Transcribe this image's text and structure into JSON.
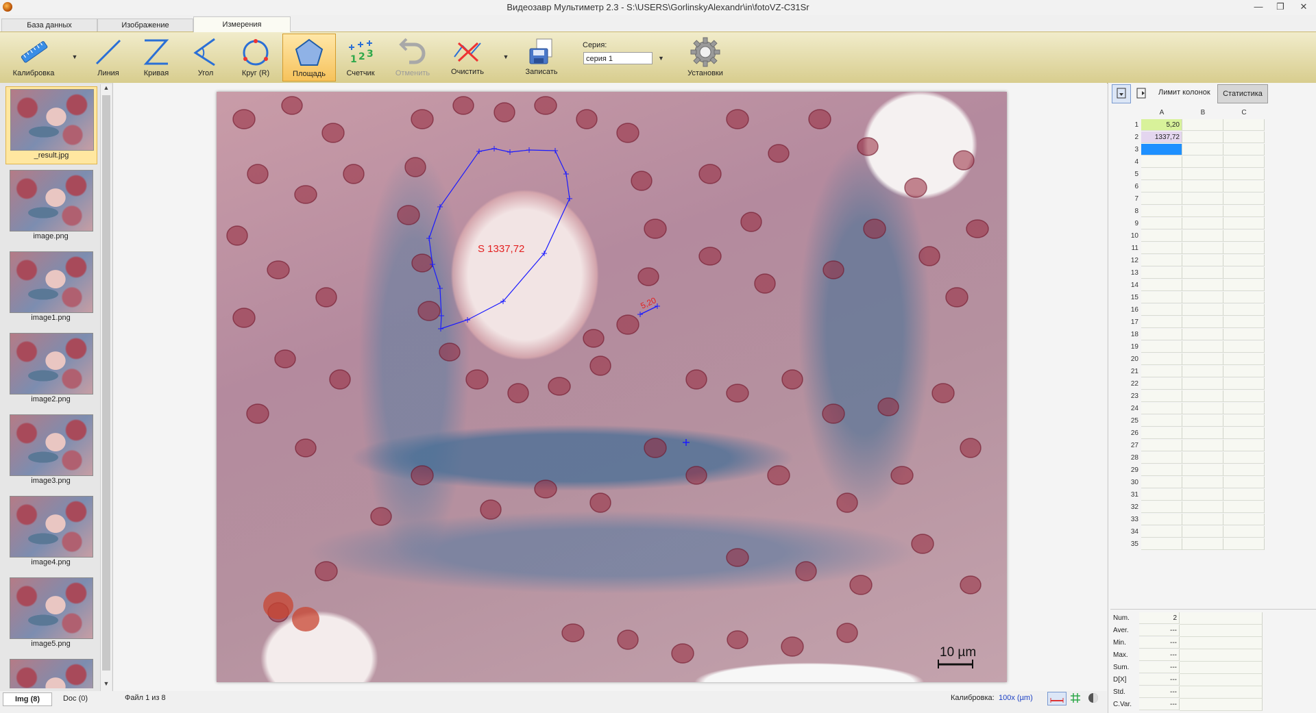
{
  "window": {
    "title": "Видеозавр Мультиметр 2.3 - S:\\USERS\\GorlinskyAlexandr\\in\\fotoVZ-C31Sr",
    "minimize": "—",
    "restore": "❐",
    "close": "✕"
  },
  "tabs": [
    {
      "label": "База данных"
    },
    {
      "label": "Изображение"
    },
    {
      "label": "Измерения"
    }
  ],
  "ribbon": {
    "tools": [
      {
        "label": "Калибровка",
        "icon": "ruler-icon"
      },
      {
        "label": "Линия",
        "icon": "line-icon"
      },
      {
        "label": "Кривая",
        "icon": "curve-icon"
      },
      {
        "label": "Угол",
        "icon": "angle-icon"
      },
      {
        "label": "Круг (R)",
        "icon": "circle-icon"
      },
      {
        "label": "Площадь",
        "icon": "pentagon-icon"
      },
      {
        "label": "Счетчик",
        "icon": "counter-icon"
      },
      {
        "label": "Отменить",
        "icon": "undo-icon"
      },
      {
        "label": "Очистить",
        "icon": "clear-icon"
      },
      {
        "label": "Записать",
        "icon": "save-icon"
      },
      {
        "label": "Установки",
        "icon": "gear-icon"
      }
    ],
    "series_label": "Серия:",
    "series_value": "серия 1"
  },
  "thumbnails": [
    {
      "name": "_result.jpg"
    },
    {
      "name": "image.png"
    },
    {
      "name": "image1.png"
    },
    {
      "name": "image2.png"
    },
    {
      "name": "image3.png"
    },
    {
      "name": "image4.png"
    },
    {
      "name": "image5.png"
    }
  ],
  "image_tabs": [
    {
      "label": "Img (8)"
    },
    {
      "label": "Doc (0)"
    }
  ],
  "measurements": {
    "area_label": "S 1337,72",
    "line_label": "5,20",
    "scale_bar": "10 µm"
  },
  "status": {
    "file": "Файл 1 из 8",
    "calibration_label": "Калибровка:",
    "calibration_value": "100x (µm)"
  },
  "right_panel": {
    "column_limit": "Лимит колонок",
    "statistics": "Статистика",
    "columns": [
      "A",
      "B",
      "C"
    ],
    "rows": [
      {
        "n": "1",
        "a": "5,20"
      },
      {
        "n": "2",
        "a": "1337,72"
      },
      {
        "n": "3",
        "a": ""
      },
      {
        "n": "4",
        "a": ""
      },
      {
        "n": "5",
        "a": ""
      },
      {
        "n": "6",
        "a": ""
      },
      {
        "n": "7",
        "a": ""
      },
      {
        "n": "8",
        "a": ""
      },
      {
        "n": "9",
        "a": ""
      },
      {
        "n": "10",
        "a": ""
      },
      {
        "n": "11",
        "a": ""
      },
      {
        "n": "12",
        "a": ""
      },
      {
        "n": "13",
        "a": ""
      },
      {
        "n": "14",
        "a": ""
      },
      {
        "n": "15",
        "a": ""
      },
      {
        "n": "16",
        "a": ""
      },
      {
        "n": "17",
        "a": ""
      },
      {
        "n": "18",
        "a": ""
      },
      {
        "n": "19",
        "a": ""
      },
      {
        "n": "20",
        "a": ""
      },
      {
        "n": "21",
        "a": ""
      },
      {
        "n": "22",
        "a": ""
      },
      {
        "n": "23",
        "a": ""
      },
      {
        "n": "24",
        "a": ""
      },
      {
        "n": "25",
        "a": ""
      },
      {
        "n": "26",
        "a": ""
      },
      {
        "n": "27",
        "a": ""
      },
      {
        "n": "28",
        "a": ""
      },
      {
        "n": "29",
        "a": ""
      },
      {
        "n": "30",
        "a": ""
      },
      {
        "n": "31",
        "a": ""
      },
      {
        "n": "32",
        "a": ""
      },
      {
        "n": "33",
        "a": ""
      },
      {
        "n": "34",
        "a": ""
      },
      {
        "n": "35",
        "a": ""
      }
    ],
    "stats": [
      {
        "name": "Num.",
        "value": "2"
      },
      {
        "name": "Aver.",
        "value": "---"
      },
      {
        "name": "Min.",
        "value": "---"
      },
      {
        "name": "Max.",
        "value": "---"
      },
      {
        "name": "Sum.",
        "value": "---"
      },
      {
        "name": "D[X]",
        "value": "---"
      },
      {
        "name": "Std.",
        "value": "---"
      },
      {
        "name": "C.Var.",
        "value": "---"
      }
    ]
  },
  "colors": {
    "accent_selected": "#ffe7a0",
    "cell_highlight_green": "#d8f29a",
    "cell_highlight_purple": "#e4d6ef",
    "cell_selected_blue": "#1e90ff",
    "measure_line": "#1a1aff",
    "measure_text": "#e32020"
  }
}
